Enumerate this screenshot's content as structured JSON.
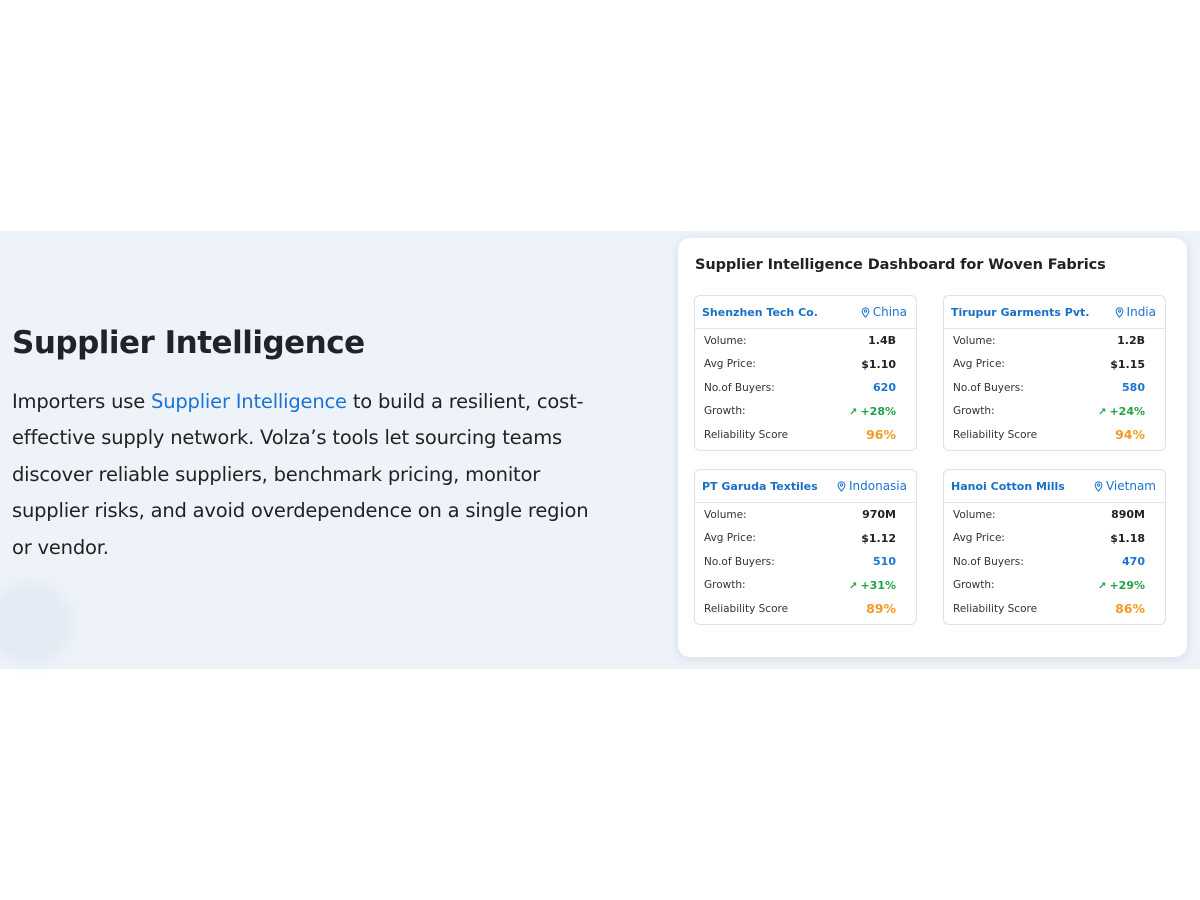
{
  "intro": {
    "heading": "Supplier Intelligence",
    "text_before": "Importers use ",
    "link_text": "Supplier Intelligence",
    "text_after": " to build a resilient, cost-effective supply network. Volza’s tools let sourcing teams discover reliable suppliers, benchmark pricing, monitor supplier risks, and avoid overdependence on a single region or vendor."
  },
  "dashboard": {
    "title": "Supplier Intelligence Dashboard for Woven Fabrics",
    "labels": {
      "volume": "Volume:",
      "avg_price": "Avg Price:",
      "buyers": "No.of Buyers:",
      "growth": "Growth:",
      "reliability": "Reliability Score"
    },
    "cards": [
      {
        "name": "Shenzhen Tech Co.",
        "location": "China",
        "volume": "1.4B",
        "avg_price": "$1.10",
        "buyers": "620",
        "growth": "+28%",
        "reliability": "96%"
      },
      {
        "name": "Tirupur Garments Pvt.",
        "location": "India",
        "volume": "1.2B",
        "avg_price": "$1.15",
        "buyers": "580",
        "growth": "+24%",
        "reliability": "94%"
      },
      {
        "name": "PT Garuda Textiles",
        "location": "Indonasia",
        "volume": "970M",
        "avg_price": "$1.12",
        "buyers": "510",
        "growth": "+31%",
        "reliability": "89%"
      },
      {
        "name": "Hanoi Cotton Mills",
        "location": "Vietnam",
        "volume": "890M",
        "avg_price": "$1.18",
        "buyers": "470",
        "growth": "+29%",
        "reliability": "86%"
      }
    ]
  },
  "colors": {
    "accent_blue": "#1a74d2",
    "growth_green": "#22a04a",
    "score_orange": "#f29a24",
    "band_bg": "#eef3f9"
  },
  "icons": {
    "location": "map-pin-icon",
    "growth": "trend-up-icon"
  }
}
